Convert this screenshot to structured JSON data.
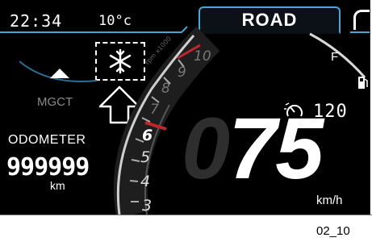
{
  "top_bar": {
    "time": "22:34",
    "temperature": "10°c",
    "mode": "ROAD"
  },
  "left_panel": {
    "mgct_label": "MGCT",
    "odometer_label": "ODOMETER",
    "odometer_value": "999999",
    "odometer_unit": "km"
  },
  "tach": {
    "scale_numbers": [
      "3",
      "4",
      "5",
      "6",
      "7",
      "8",
      "9",
      "10"
    ],
    "multiplier": "rpm x1000"
  },
  "fuel": {
    "full": "F"
  },
  "cruise": {
    "set_speed": "120"
  },
  "speed": {
    "value": "75",
    "ghost_digit": "0",
    "unit": "km/h"
  },
  "figure_code": "02_10",
  "icons": [
    "snowflake-icon",
    "mgct-up-icon",
    "pointer-arrow-icon",
    "cruise-control-icon",
    "fuel-pump-icon"
  ]
}
